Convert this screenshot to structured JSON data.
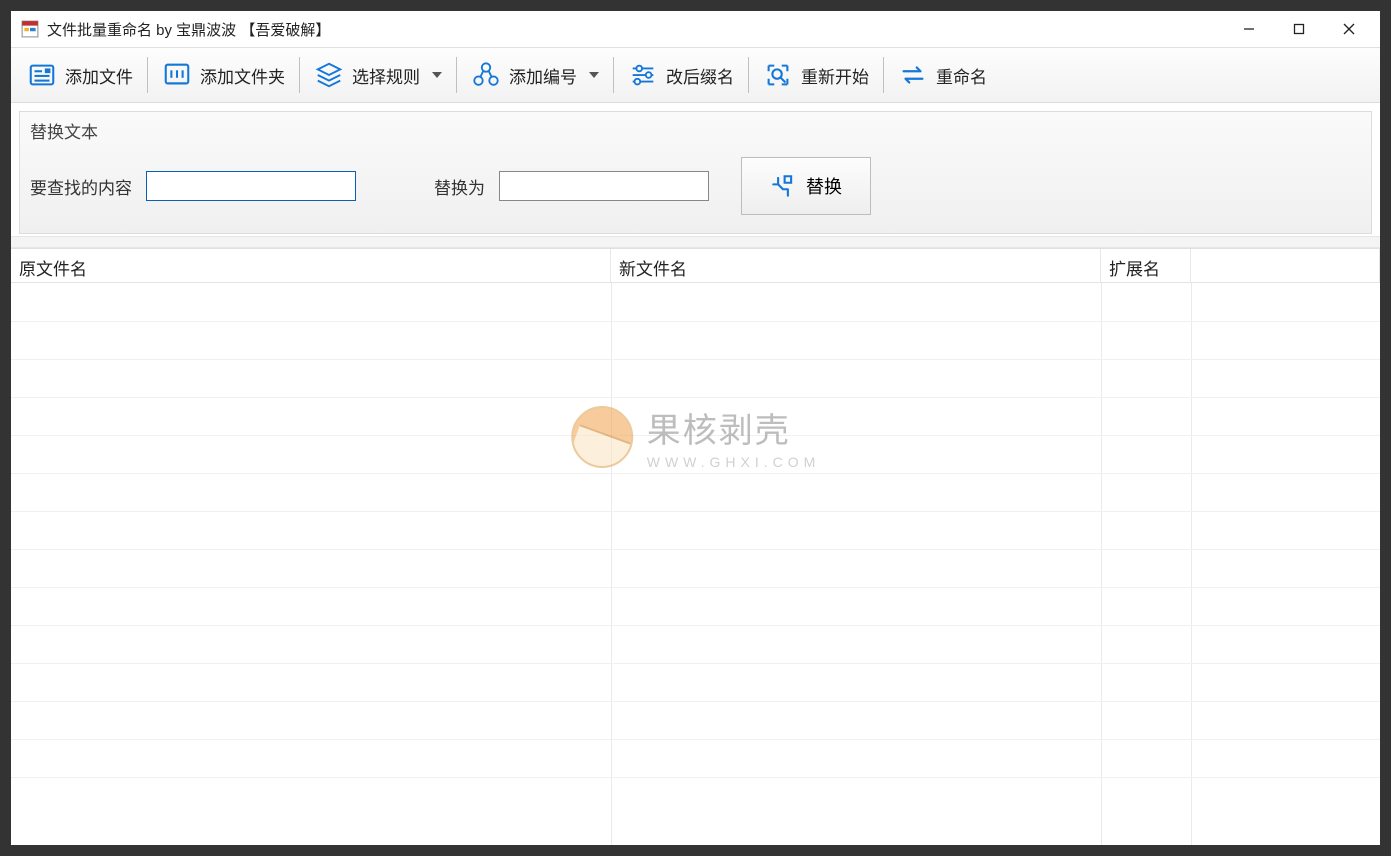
{
  "window": {
    "title": "文件批量重命名 by 宝鼎波波 【吾爱破解】"
  },
  "toolbar": {
    "add_file": "添加文件",
    "add_folder": "添加文件夹",
    "select_rule": "选择规则",
    "add_number": "添加编号",
    "change_ext": "改后缀名",
    "restart": "重新开始",
    "rename": "重命名"
  },
  "panel": {
    "title": "替换文本",
    "find_label": "要查找的内容",
    "replace_label": "替换为",
    "find_value": "",
    "replace_value": "",
    "replace_btn": "替换"
  },
  "table": {
    "columns": {
      "original": "原文件名",
      "new": "新文件名",
      "ext": "扩展名"
    }
  },
  "watermark": {
    "main": "果核剥壳",
    "sub": "WWW.GHXI.COM"
  }
}
